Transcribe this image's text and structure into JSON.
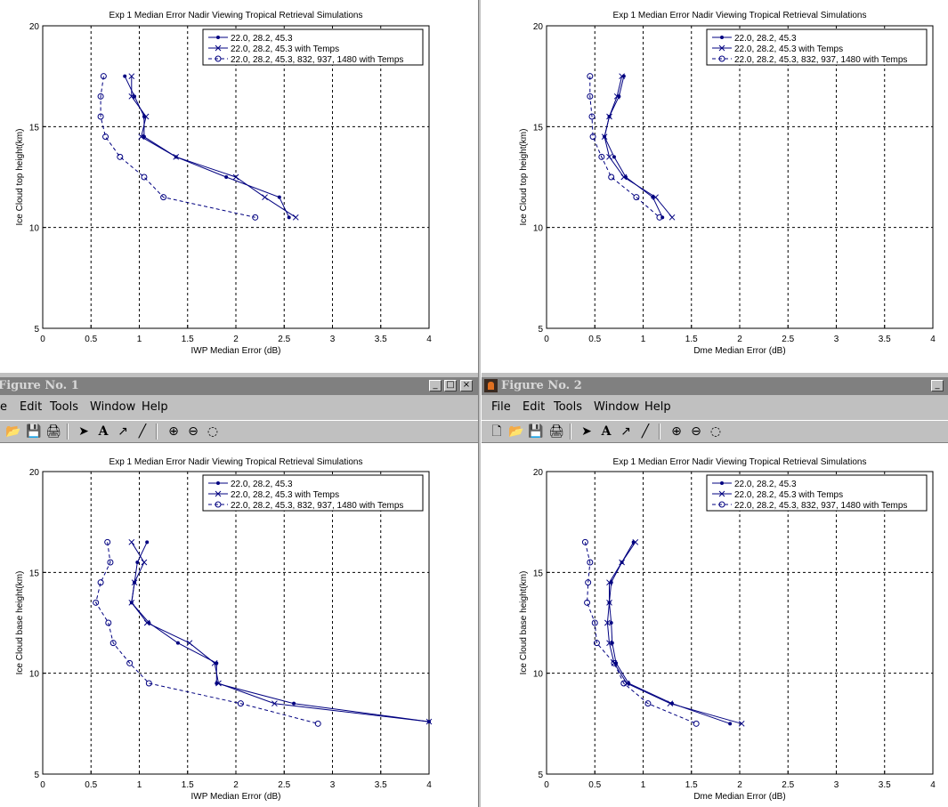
{
  "windows": [
    {
      "title": "Figure No. 1",
      "menu": [
        "e",
        "Edit",
        "Tools",
        "Window",
        "Help"
      ],
      "controls": [
        "_",
        "□",
        "×"
      ]
    },
    {
      "title": "Figure No. 2",
      "menu": [
        "File",
        "Edit",
        "Tools",
        "Window",
        "Help"
      ],
      "controls": [
        "_"
      ]
    }
  ],
  "colors": {
    "series": "#000080",
    "axis": "#000000",
    "grid": "#000000",
    "background": "#ffffff",
    "window_gray": "#c0c0c0",
    "titlebar": "#808080"
  },
  "chart_data": [
    {
      "type": "line",
      "title": "Exp 1 Median Error Nadir Viewing Tropical Retrieval Simulations",
      "xlabel": "IWP Median Error (dB)",
      "ylabel": "Ice Cloud top height(km)",
      "xlim": [
        0,
        4
      ],
      "ylim": [
        5,
        20
      ],
      "xticks": [
        "0",
        "0.5",
        "1",
        "1.5",
        "2",
        "2.5",
        "3",
        "3.5",
        "4"
      ],
      "yticks": [
        "5",
        "10",
        "15",
        "20"
      ],
      "grid": true,
      "legend_position": "top-right",
      "series": [
        {
          "name": "22.0, 28.2, 45.3",
          "marker": "dot",
          "dash": "solid",
          "x": [
            0.85,
            0.95,
            1.05,
            1.05,
            1.38,
            1.9,
            2.45,
            2.55
          ],
          "y": [
            17.5,
            16.5,
            15.5,
            14.5,
            13.5,
            12.5,
            11.5,
            10.5
          ]
        },
        {
          "name": "22.0, 28.2, 45.3 with Temps",
          "marker": "x",
          "dash": "solid",
          "x": [
            0.92,
            0.92,
            1.07,
            1.02,
            1.38,
            2.0,
            2.3,
            2.62
          ],
          "y": [
            17.5,
            16.5,
            15.5,
            14.5,
            13.5,
            12.5,
            11.5,
            10.5
          ]
        },
        {
          "name": "22.0, 28.2, 45.3, 832, 937, 1480 with Temps",
          "marker": "circle",
          "dash": "dashed",
          "x": [
            0.63,
            0.6,
            0.6,
            0.65,
            0.8,
            1.05,
            1.25,
            2.2
          ],
          "y": [
            17.5,
            16.5,
            15.5,
            14.5,
            13.5,
            12.5,
            11.5,
            10.5
          ]
        }
      ]
    },
    {
      "type": "line",
      "title": "Exp 1 Median Error Nadir Viewing Tropical Retrieval Simulations",
      "xlabel": "Dme Median Error (dB)",
      "ylabel": "Ice Cloud top height(km)",
      "xlim": [
        0,
        4
      ],
      "ylim": [
        5,
        20
      ],
      "xticks": [
        "0",
        "0.5",
        "1",
        "1.5",
        "2",
        "2.5",
        "3",
        "3.5",
        "4"
      ],
      "yticks": [
        "5",
        "10",
        "15",
        "20"
      ],
      "grid": true,
      "legend_position": "top-right",
      "series": [
        {
          "name": "22.0, 28.2, 45.3",
          "marker": "dot",
          "dash": "solid",
          "x": [
            0.8,
            0.75,
            0.65,
            0.6,
            0.7,
            0.82,
            1.1,
            1.2
          ],
          "y": [
            17.5,
            16.5,
            15.5,
            14.5,
            13.5,
            12.5,
            11.5,
            10.5
          ]
        },
        {
          "name": "22.0, 28.2, 45.3 with Temps",
          "marker": "x",
          "dash": "solid",
          "x": [
            0.78,
            0.73,
            0.65,
            0.6,
            0.65,
            0.8,
            1.13,
            1.3
          ],
          "y": [
            17.5,
            16.5,
            15.5,
            14.5,
            13.5,
            12.5,
            11.5,
            10.5
          ]
        },
        {
          "name": "22.0, 28.2, 45.3, 832, 937, 1480 with Temps",
          "marker": "circle",
          "dash": "dashed",
          "x": [
            0.45,
            0.45,
            0.47,
            0.48,
            0.57,
            0.67,
            0.93,
            1.17
          ],
          "y": [
            17.5,
            16.5,
            15.5,
            14.5,
            13.5,
            12.5,
            11.5,
            10.5
          ]
        }
      ]
    },
    {
      "type": "line",
      "title": "Exp 1 Median Error Nadir Viewing Tropical Retrieval Simulations",
      "xlabel": "IWP Median Error (dB)",
      "ylabel": "Ice Cloud base height(km)",
      "xlim": [
        0,
        4
      ],
      "ylim": [
        5,
        20
      ],
      "xticks": [
        "0",
        "0.5",
        "1",
        "1.5",
        "2",
        "2.5",
        "3",
        "3.5",
        "4"
      ],
      "yticks": [
        "5",
        "10",
        "15",
        "20"
      ],
      "grid": true,
      "legend_position": "top-right",
      "series": [
        {
          "name": "22.0, 28.2, 45.3",
          "marker": "dot",
          "dash": "solid",
          "x": [
            1.08,
            0.98,
            0.95,
            0.92,
            1.1,
            1.4,
            1.8,
            1.8,
            2.6,
            4.0
          ],
          "y": [
            16.5,
            15.5,
            14.5,
            13.5,
            12.5,
            11.5,
            10.5,
            9.5,
            8.5,
            7.6
          ]
        },
        {
          "name": "22.0, 28.2, 45.3 with Temps",
          "marker": "x",
          "dash": "solid",
          "x": [
            0.92,
            1.05,
            0.95,
            0.92,
            1.08,
            1.52,
            1.78,
            1.82,
            2.4,
            4.0
          ],
          "y": [
            16.5,
            15.5,
            14.5,
            13.5,
            12.5,
            11.5,
            10.5,
            9.5,
            8.5,
            7.6
          ]
        },
        {
          "name": "22.0, 28.2, 45.3, 832, 937, 1480 with Temps",
          "marker": "circle",
          "dash": "dashed",
          "x": [
            0.67,
            0.7,
            0.6,
            0.55,
            0.68,
            0.73,
            0.9,
            1.1,
            2.05,
            2.85
          ],
          "y": [
            16.5,
            15.5,
            14.5,
            13.5,
            12.5,
            11.5,
            10.5,
            9.5,
            8.5,
            7.5
          ]
        }
      ]
    },
    {
      "type": "line",
      "title": "Exp 1 Median Error Nadir Viewing Tropical Retrieval Simulations",
      "xlabel": "Dme Median Error (dB)",
      "ylabel": "Ice Cloud base height(km)",
      "xlim": [
        0,
        4
      ],
      "ylim": [
        5,
        20
      ],
      "xticks": [
        "0",
        "0.5",
        "1",
        "1.5",
        "2",
        "2.5",
        "3",
        "3.5",
        "4"
      ],
      "yticks": [
        "5",
        "10",
        "15",
        "20"
      ],
      "grid": true,
      "legend_position": "top-right",
      "series": [
        {
          "name": "22.0, 28.2, 45.3",
          "marker": "dot",
          "dash": "solid",
          "x": [
            0.9,
            0.78,
            0.67,
            0.65,
            0.67,
            0.68,
            0.72,
            0.85,
            1.3,
            1.9
          ],
          "y": [
            16.5,
            15.5,
            14.5,
            13.5,
            12.5,
            11.5,
            10.5,
            9.5,
            8.5,
            7.5
          ]
        },
        {
          "name": "22.0, 28.2, 45.3 with Temps",
          "marker": "x",
          "dash": "solid",
          "x": [
            0.92,
            0.78,
            0.65,
            0.65,
            0.63,
            0.65,
            0.7,
            0.83,
            1.28,
            2.02
          ],
          "y": [
            16.5,
            15.5,
            14.5,
            13.5,
            12.5,
            11.5,
            10.5,
            9.5,
            8.5,
            7.5
          ]
        },
        {
          "name": "22.0, 28.2, 45.3, 832, 937, 1480 with Temps",
          "marker": "circle",
          "dash": "dashed",
          "x": [
            0.4,
            0.45,
            0.43,
            0.42,
            0.5,
            0.52,
            0.7,
            0.8,
            1.05,
            1.55
          ],
          "y": [
            16.5,
            15.5,
            14.5,
            13.5,
            12.5,
            11.5,
            10.5,
            9.5,
            8.5,
            7.5
          ]
        }
      ]
    }
  ]
}
